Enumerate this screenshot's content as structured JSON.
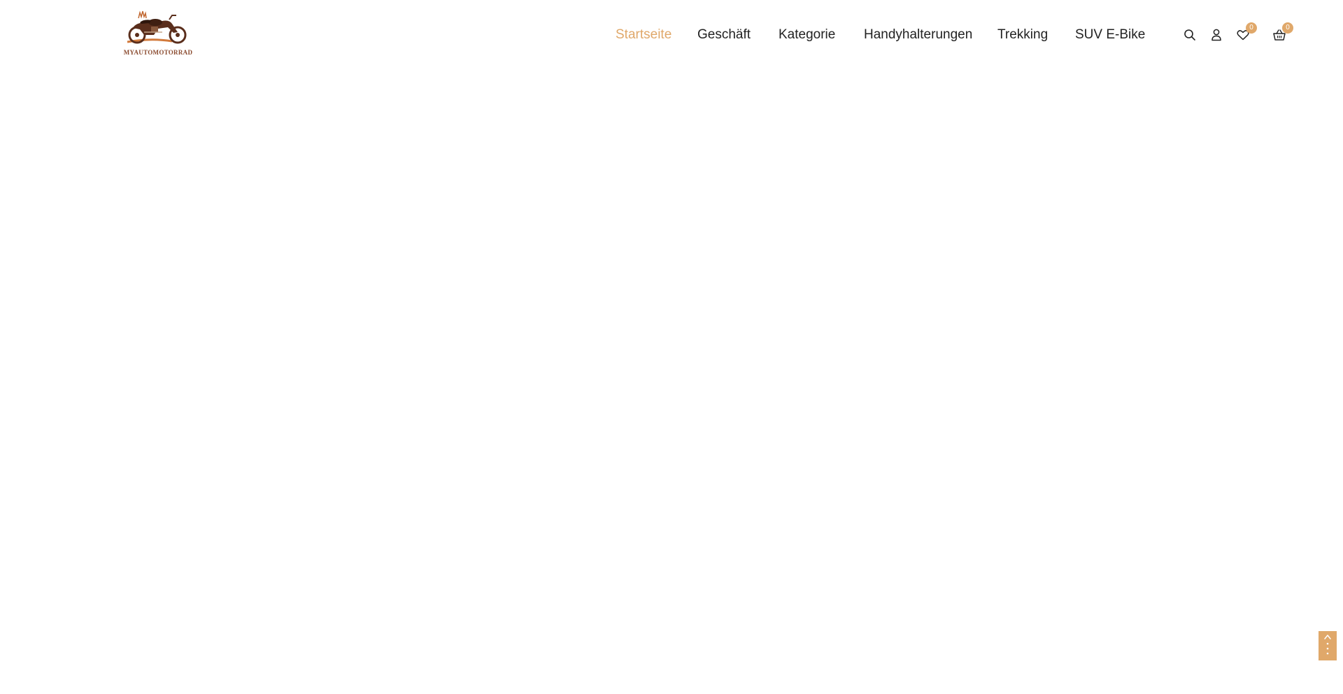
{
  "brand": {
    "logo_text": "MYAUTOMOTORRAD",
    "logo_icon": "motorcycle-logo"
  },
  "nav": {
    "items": [
      {
        "label": "Startseite",
        "active": true
      },
      {
        "label": "Geschäft",
        "active": false
      },
      {
        "label": "Kategorie",
        "active": false
      },
      {
        "label": "Handyhalterungen",
        "active": false
      },
      {
        "label": "Trekking",
        "active": false
      },
      {
        "label": "SUV E-Bike",
        "active": false
      }
    ]
  },
  "header_tools": {
    "search_icon": "search-icon",
    "account_icon": "user-icon",
    "wishlist": {
      "icon": "heart-icon",
      "count": "0"
    },
    "cart": {
      "icon": "basket-icon",
      "count": "0"
    }
  },
  "back_to_top": {
    "icon": "arrow-up-icon"
  },
  "colors": {
    "accent": "#e0a86a",
    "text": "#222222",
    "background": "#ffffff",
    "logo_brown": "#5a2e1c"
  }
}
